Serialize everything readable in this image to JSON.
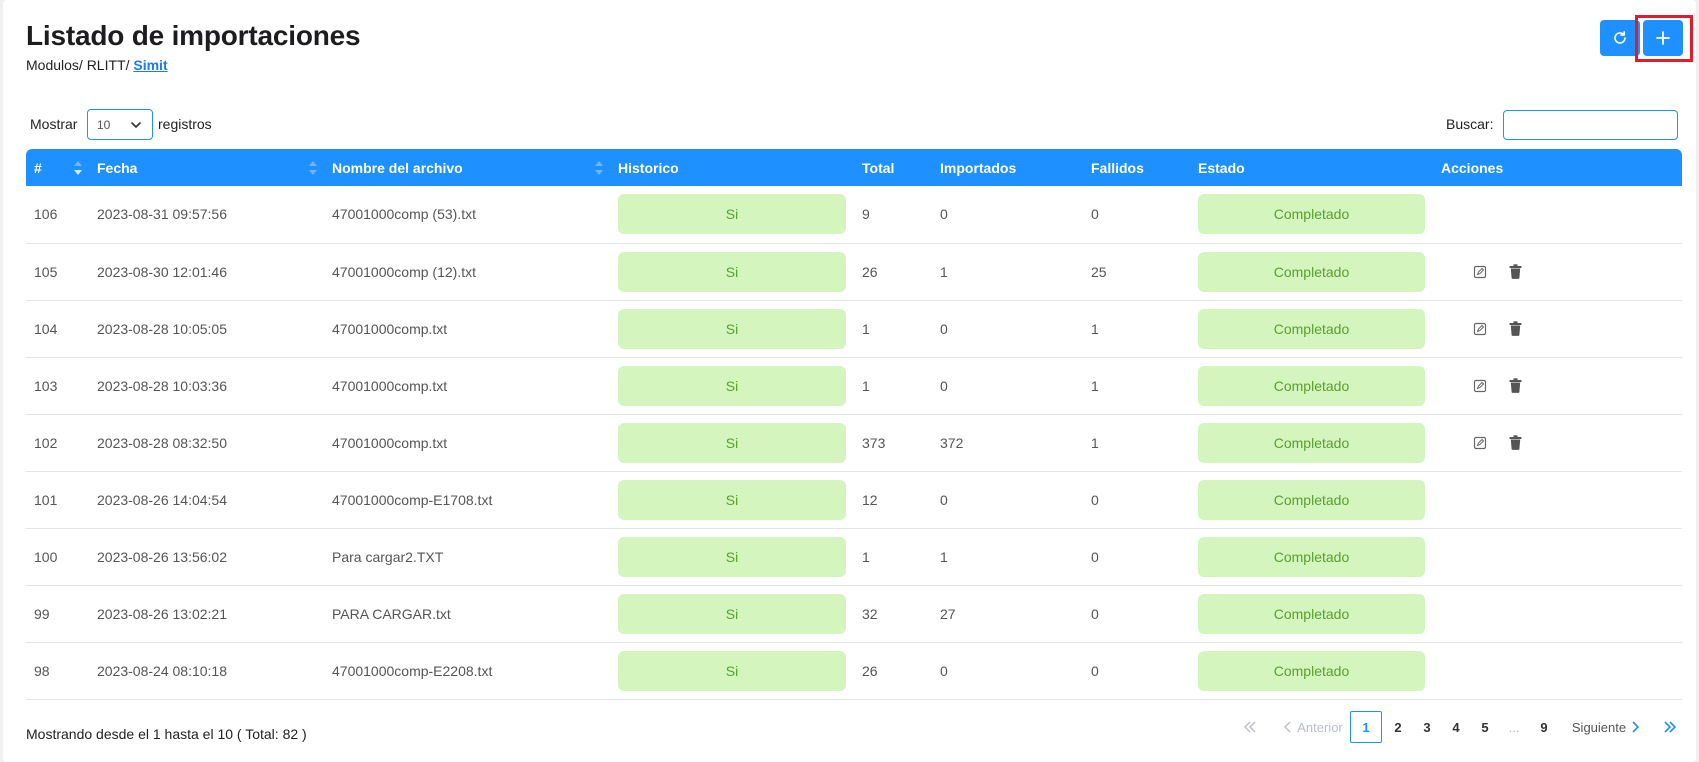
{
  "header": {
    "title": "Listado de importaciones",
    "breadcrumb": {
      "prefix": "Modulos/ RLITT/ ",
      "current": "Simit"
    }
  },
  "toolbar": {
    "refresh_icon": "refresh-icon",
    "add_icon": "plus-icon"
  },
  "controls": {
    "show_label": "Mostrar",
    "page_length": "10",
    "registros_label": "registros",
    "search_label": "Buscar:",
    "search_value": ""
  },
  "table": {
    "columns": [
      "#",
      "Fecha",
      "Nombre del archivo",
      "Historico",
      "Total",
      "Importados",
      "Fallidos",
      "Estado",
      "Acciones"
    ],
    "rows": [
      {
        "id": "106",
        "fecha": "2023-08-31 09:57:56",
        "archivo": "47001000comp (53).txt",
        "historico": "Si",
        "total": "9",
        "importados": "0",
        "fallidos": "0",
        "estado": "Completado",
        "has_actions": false
      },
      {
        "id": "105",
        "fecha": "2023-08-30 12:01:46",
        "archivo": "47001000comp (12).txt",
        "historico": "Si",
        "total": "26",
        "importados": "1",
        "fallidos": "25",
        "estado": "Completado",
        "has_actions": true
      },
      {
        "id": "104",
        "fecha": "2023-08-28 10:05:05",
        "archivo": "47001000comp.txt",
        "historico": "Si",
        "total": "1",
        "importados": "0",
        "fallidos": "1",
        "estado": "Completado",
        "has_actions": true
      },
      {
        "id": "103",
        "fecha": "2023-08-28 10:03:36",
        "archivo": "47001000comp.txt",
        "historico": "Si",
        "total": "1",
        "importados": "0",
        "fallidos": "1",
        "estado": "Completado",
        "has_actions": true
      },
      {
        "id": "102",
        "fecha": "2023-08-28 08:32:50",
        "archivo": "47001000comp.txt",
        "historico": "Si",
        "total": "373",
        "importados": "372",
        "fallidos": "1",
        "estado": "Completado",
        "has_actions": true
      },
      {
        "id": "101",
        "fecha": "2023-08-26 14:04:54",
        "archivo": "47001000comp-E1708.txt",
        "historico": "Si",
        "total": "12",
        "importados": "0",
        "fallidos": "0",
        "estado": "Completado",
        "has_actions": false
      },
      {
        "id": "100",
        "fecha": "2023-08-26 13:56:02",
        "archivo": "Para cargar2.TXT",
        "historico": "Si",
        "total": "1",
        "importados": "1",
        "fallidos": "0",
        "estado": "Completado",
        "has_actions": false
      },
      {
        "id": "99",
        "fecha": "2023-08-26 13:02:21",
        "archivo": "PARA CARGAR.txt",
        "historico": "Si",
        "total": "32",
        "importados": "27",
        "fallidos": "0",
        "estado": "Completado",
        "has_actions": false
      },
      {
        "id": "98",
        "fecha": "2023-08-24 08:10:18",
        "archivo": "47001000comp-E2208.txt",
        "historico": "Si",
        "total": "26",
        "importados": "0",
        "fallidos": "0",
        "estado": "Completado",
        "has_actions": false
      }
    ]
  },
  "footer": {
    "info": "Mostrando desde el 1 hasta el 10 ( Total: 82 )",
    "pagination": {
      "previous": "Anterior",
      "next": "Siguiente",
      "pages": [
        "1",
        "2",
        "3",
        "4",
        "5",
        "...",
        "9"
      ],
      "active": "1"
    }
  },
  "colors": {
    "primary": "#1e90ff",
    "pill_bg": "#d5f5bf",
    "pill_text": "#5a9f2e",
    "highlight": "#e11d2a"
  }
}
